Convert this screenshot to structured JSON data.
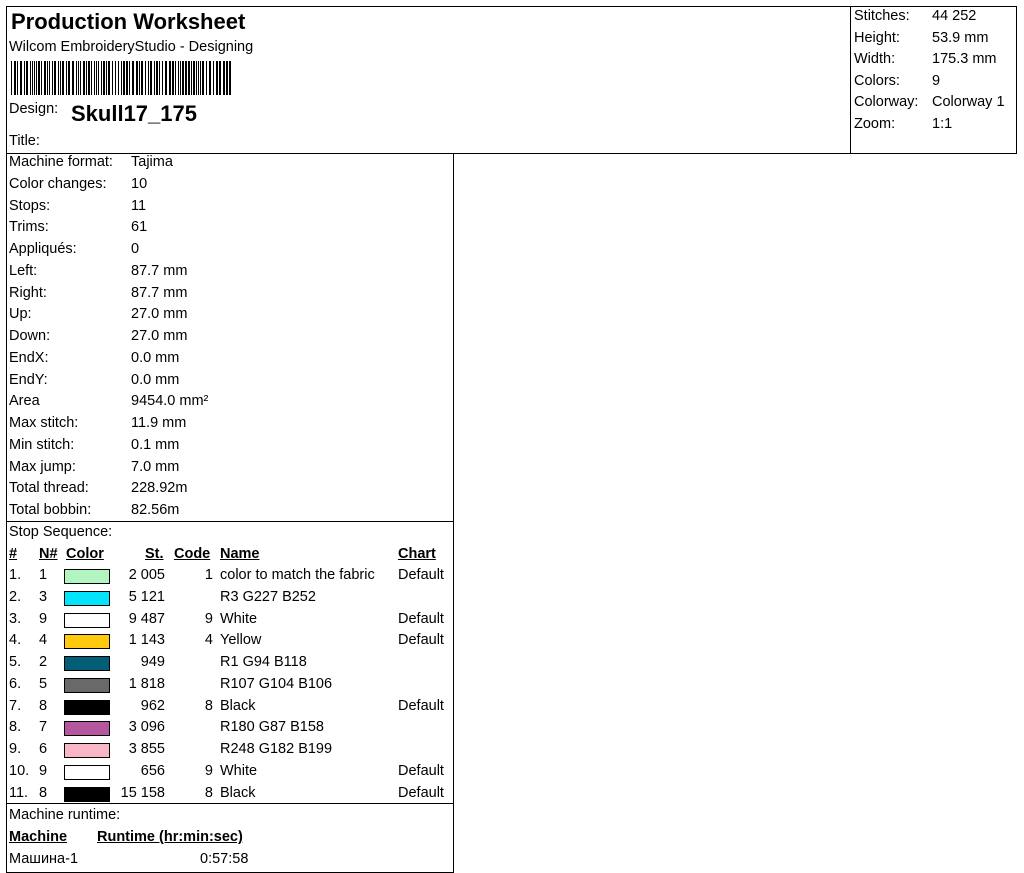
{
  "header": {
    "title": "Production Worksheet",
    "subtitle": "Wilcom EmbroideryStudio - Designing",
    "design_label": "Design:",
    "design_value": "Skull17_175",
    "title_label": "Title:"
  },
  "stats": [
    {
      "label": "Stitches:",
      "value": "44 252"
    },
    {
      "label": "Height:",
      "value": "53.9 mm"
    },
    {
      "label": "Width:",
      "value": "175.3 mm"
    },
    {
      "label": "Colors:",
      "value": "9"
    },
    {
      "label": "Colorway:",
      "value": "Colorway 1"
    },
    {
      "label": "Zoom:",
      "value": "1:1"
    }
  ],
  "properties": [
    {
      "label": "Machine format:",
      "value": "Tajima"
    },
    {
      "label": "Color changes:",
      "value": "10"
    },
    {
      "label": "Stops:",
      "value": "11"
    },
    {
      "label": "Trims:",
      "value": "61"
    },
    {
      "label": "Appliqués:",
      "value": "0"
    },
    {
      "label": "Left:",
      "value": "87.7 mm"
    },
    {
      "label": "Right:",
      "value": "87.7 mm"
    },
    {
      "label": "Up:",
      "value": "27.0 mm"
    },
    {
      "label": "Down:",
      "value": "27.0 mm"
    },
    {
      "label": "EndX:",
      "value": "0.0 mm"
    },
    {
      "label": "EndY:",
      "value": "0.0 mm"
    },
    {
      "label": "Area",
      "value": "9454.0 mm²"
    },
    {
      "label": "Max stitch:",
      "value": "11.9 mm"
    },
    {
      "label": "Min stitch:",
      "value": "0.1 mm"
    },
    {
      "label": "Max jump:",
      "value": "7.0 mm"
    },
    {
      "label": "Total thread:",
      "value": "228.92m"
    },
    {
      "label": "Total bobbin:",
      "value": "82.56m"
    }
  ],
  "stop_sequence": {
    "label": "Stop Sequence:",
    "headers": {
      "idx": "#",
      "n": "N#",
      "color": "Color",
      "st": "St.",
      "code": "Code",
      "name": "Name",
      "chart": "Chart"
    },
    "rows": [
      {
        "idx": "1.",
        "n": "1",
        "color": "#b3f5c0",
        "st": "2 005",
        "code": "1",
        "name": "color to match the fabric",
        "chart": "Default"
      },
      {
        "idx": "2.",
        "n": "3",
        "color": "#03e3fc",
        "st": "5 121",
        "code": "",
        "name": "R3 G227 B252",
        "chart": ""
      },
      {
        "idx": "3.",
        "n": "9",
        "color": "#ffffff",
        "st": "9 487",
        "code": "9",
        "name": "White",
        "chart": "Default"
      },
      {
        "idx": "4.",
        "n": "4",
        "color": "#ffc90e",
        "st": "1 143",
        "code": "4",
        "name": "Yellow",
        "chart": "Default"
      },
      {
        "idx": "5.",
        "n": "2",
        "color": "#015e76",
        "st": "949",
        "code": "",
        "name": "R1 G94 B118",
        "chart": ""
      },
      {
        "idx": "6.",
        "n": "5",
        "color": "#6b686a",
        "st": "1 818",
        "code": "",
        "name": "R107 G104 B106",
        "chart": ""
      },
      {
        "idx": "7.",
        "n": "8",
        "color": "#000000",
        "st": "962",
        "code": "8",
        "name": "Black",
        "chart": "Default"
      },
      {
        "idx": "8.",
        "n": "7",
        "color": "#b4579e",
        "st": "3 096",
        "code": "",
        "name": "R180 G87 B158",
        "chart": ""
      },
      {
        "idx": "9.",
        "n": "6",
        "color": "#f8b6c7",
        "st": "3 855",
        "code": "",
        "name": "R248 G182 B199",
        "chart": ""
      },
      {
        "idx": "10.",
        "n": "9",
        "color": "#ffffff",
        "st": "656",
        "code": "9",
        "name": "White",
        "chart": "Default"
      },
      {
        "idx": "11.",
        "n": "8",
        "color": "#000000",
        "st": "15 158",
        "code": "8",
        "name": "Black",
        "chart": "Default"
      }
    ]
  },
  "runtime": {
    "label": "Machine runtime:",
    "headers": {
      "machine": "Machine",
      "runtime": "Runtime (hr:min:sec)"
    },
    "rows": [
      {
        "machine": "Машина-1",
        "runtime": "0:57:58"
      }
    ]
  }
}
